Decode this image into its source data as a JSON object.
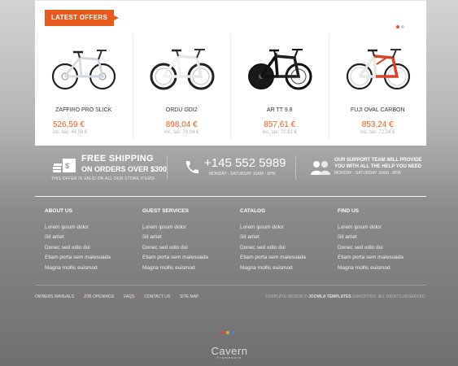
{
  "offers": {
    "title": "Latest Offers",
    "products": [
      {
        "name": "ZAFFIRO PRO SLICK",
        "price": "526,59 €",
        "tax": "inc. tax: 44,59 €"
      },
      {
        "name": "ORDU GDI2",
        "price": "898,04 €",
        "tax": "inc. tax: 76,04 €"
      },
      {
        "name": "AR TT 9.8",
        "price": "857,61 €",
        "tax": "inc. tax: 72,61 €"
      },
      {
        "name": "FUJI OVAL CARBON",
        "price": "853,24 €",
        "tax": "inc. tax: 72,24 €"
      }
    ]
  },
  "features": {
    "shipping_title": "FREE SHIPPING",
    "shipping_subtitle": "ON ORDERS OVER $300",
    "shipping_note": "THIS OFFER IS VALID ON ALL OUR STORE ITEMS!",
    "phone": "+145 552 5989",
    "phone_hours": "MONDAY - SATURDAY 10AM - 8PM",
    "support_line1": "OUR SUPPORT TEAM WILL PROVIDE",
    "support_line2": "YOU WITH ALL THE HELP YOU NEED",
    "support_hours": "MONDAY - SATURDAY 10AM - 8PM"
  },
  "footer_columns": [
    {
      "title": "ABOUT US",
      "links": [
        "Lorem ipsum dolor",
        "Sit amet",
        "Donec sed odio dui",
        "Etiam porta sem malesuada",
        "Magna mollis euismod"
      ]
    },
    {
      "title": "GUEST SERVICES",
      "links": [
        "Lorem ipsum dolor",
        "Sit amet",
        "Donec sed odio dui",
        "Etiam porta sem malesuada",
        "Magna mollis euismod"
      ]
    },
    {
      "title": "CATALOG",
      "links": [
        "Lorem ipsum dolor",
        "Sit amet",
        "Donec sed odio dui",
        "Etiam porta sem malesuada",
        "Magna mollis euismod"
      ]
    },
    {
      "title": "FIND US",
      "links": [
        "Lorem ipsum dolor",
        "Sit amet",
        "Donec sed odio dui",
        "Etiam porta sem malesuada",
        "Magna mollis euismod"
      ]
    }
  ],
  "bottom_links": [
    "Owners Manuals",
    "Job Openings",
    "FAQs",
    "Contact Us",
    "Site Map"
  ],
  "credits": {
    "prefix": "Template design ©",
    "link": "Joomla Templates",
    "suffix": "GavickPro. All rights reserved."
  },
  "logo": {
    "main": "Cavern",
    "sub": "Framework"
  },
  "colors": {
    "accent": "#e85a1e",
    "dot_red": "#e0443a",
    "dot_orange": "#e8a13a",
    "dot_blue": "#4a86c8"
  }
}
